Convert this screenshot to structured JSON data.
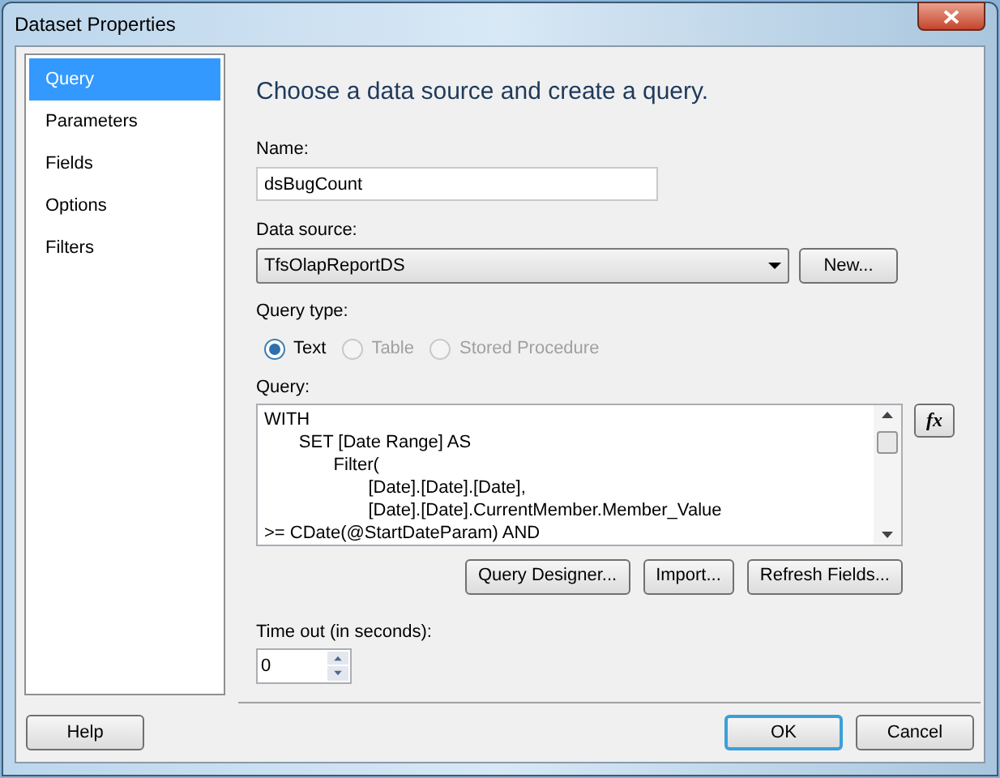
{
  "window": {
    "title": "Dataset Properties"
  },
  "sidebar": {
    "items": [
      {
        "label": "Query",
        "selected": true
      },
      {
        "label": "Parameters",
        "selected": false
      },
      {
        "label": "Fields",
        "selected": false
      },
      {
        "label": "Options",
        "selected": false
      },
      {
        "label": "Filters",
        "selected": false
      }
    ]
  },
  "heading": "Choose a data source and create a query.",
  "name": {
    "label": "Name:",
    "value": "dsBugCount"
  },
  "data_source": {
    "label": "Data source:",
    "value": "TfsOlapReportDS",
    "new_button": "New..."
  },
  "query_type": {
    "label": "Query type:",
    "options": [
      {
        "label": "Text",
        "selected": true,
        "disabled": false
      },
      {
        "label": "Table",
        "selected": false,
        "disabled": true
      },
      {
        "label": "Stored Procedure",
        "selected": false,
        "disabled": true
      }
    ]
  },
  "query": {
    "label": "Query:",
    "lines": [
      "WITH",
      "\tSET [Date Range] AS",
      "\t\tFilter(",
      "\t\t\t[Date].[Date].[Date],",
      "\t\t\t[Date].[Date].CurrentMember.Member_Value",
      ">= CDate(@StartDateParam) AND"
    ],
    "expression_button": "fx"
  },
  "query_buttons": [
    "Query Designer...",
    "Import...",
    "Refresh Fields..."
  ],
  "timeout": {
    "label": "Time out (in seconds):",
    "value": "0"
  },
  "footer": {
    "help": "Help",
    "buttons": [
      {
        "label": "OK",
        "default": true
      },
      {
        "label": "Cancel",
        "default": false
      }
    ]
  }
}
